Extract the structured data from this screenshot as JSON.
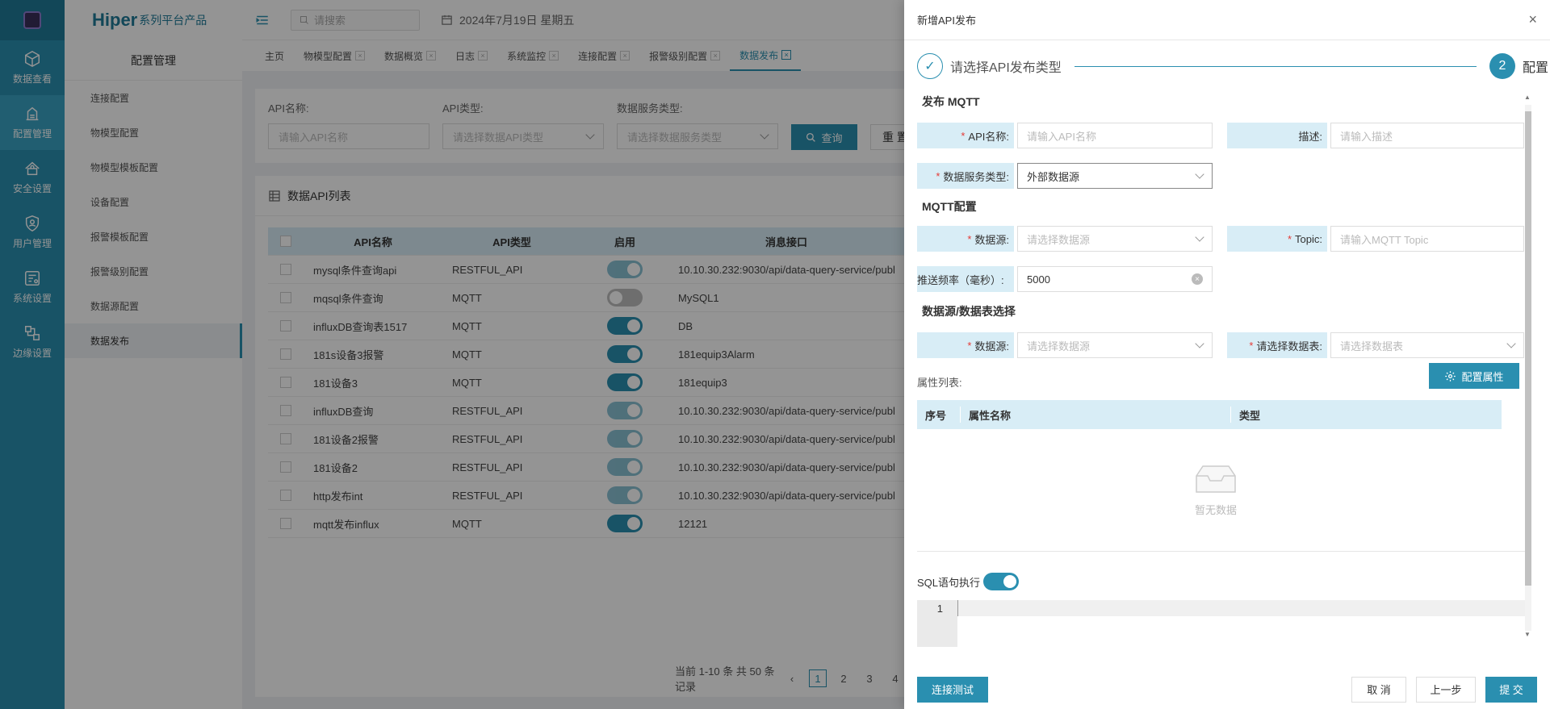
{
  "rail": {
    "items": [
      {
        "label": "数据查看",
        "icon": "cube-icon"
      },
      {
        "label": "配置管理",
        "icon": "config-icon",
        "active": true
      },
      {
        "label": "安全设置",
        "icon": "lock-icon"
      },
      {
        "label": "用户管理",
        "icon": "user-shield-icon"
      },
      {
        "label": "系统设置",
        "icon": "system-settings-icon"
      },
      {
        "label": "边缘设置",
        "icon": "edge-network-icon"
      }
    ]
  },
  "brand": {
    "name": "Hiper",
    "suffix": "系列平台产品"
  },
  "sidebar": {
    "title": "配置管理",
    "items": [
      "连接配置",
      "物模型配置",
      "物模型模板配置",
      "设备配置",
      "报警模板配置",
      "报警级别配置",
      "数据源配置",
      "数据发布"
    ],
    "active_index": 7
  },
  "header": {
    "search_placeholder": "请搜索",
    "date": "2024年7月19日 星期五"
  },
  "tabs": [
    {
      "label": "主页",
      "closable": false
    },
    {
      "label": "物模型配置",
      "closable": true
    },
    {
      "label": "数据概览",
      "closable": true
    },
    {
      "label": "日志",
      "closable": true
    },
    {
      "label": "系统监控",
      "closable": true
    },
    {
      "label": "连接配置",
      "closable": true
    },
    {
      "label": "报警级别配置",
      "closable": true
    },
    {
      "label": "数据发布",
      "closable": true,
      "active": true
    }
  ],
  "filter": {
    "api_name_label": "API名称:",
    "api_name_placeholder": "请输入API名称",
    "api_type_label": "API类型:",
    "api_type_placeholder": "请选择数据API类型",
    "service_type_label": "数据服务类型:",
    "service_type_placeholder": "请选择数据服务类型",
    "query_label": "查询",
    "reset_label": "重 置"
  },
  "table": {
    "title": "数据API列表",
    "columns": [
      "API名称",
      "API类型",
      "启用",
      "消息接口"
    ],
    "rows": [
      {
        "name": "mysql条件查询api",
        "type": "RESTFUL_API",
        "enabled": true,
        "endpoint": "10.10.30.232:9030/api/data-query-service/publ"
      },
      {
        "name": "mqsql条件查询",
        "type": "MQTT",
        "enabled": false,
        "endpoint": "MySQL1"
      },
      {
        "name": "influxDB查询表1517",
        "type": "MQTT",
        "enabled": true,
        "endpoint": "DB"
      },
      {
        "name": "181s设备3报警",
        "type": "MQTT",
        "enabled": true,
        "endpoint": "181equip3Alarm"
      },
      {
        "name": "181设备3",
        "type": "MQTT",
        "enabled": true,
        "endpoint": "181equip3"
      },
      {
        "name": "influxDB查询",
        "type": "RESTFUL_API",
        "enabled": true,
        "endpoint": "10.10.30.232:9030/api/data-query-service/publ"
      },
      {
        "name": "181设备2报警",
        "type": "RESTFUL_API",
        "enabled": true,
        "endpoint": "10.10.30.232:9030/api/data-query-service/publ"
      },
      {
        "name": "181设备2",
        "type": "RESTFUL_API",
        "enabled": true,
        "endpoint": "10.10.30.232:9030/api/data-query-service/publ"
      },
      {
        "name": "http发布int",
        "type": "RESTFUL_API",
        "enabled": true,
        "endpoint": "10.10.30.232:9030/api/data-query-service/publ"
      },
      {
        "name": "mqtt发布influx",
        "type": "MQTT",
        "enabled": true,
        "endpoint": "12121"
      }
    ],
    "pager": {
      "summary": "当前 1-10 条 共 50 条 记录",
      "prev": "‹",
      "pages": [
        "1",
        "2",
        "3",
        "4"
      ],
      "current": "1"
    }
  },
  "drawer": {
    "title": "新增API发布",
    "close": "×",
    "step1": "请选择API发布类型",
    "step1_check": "✓",
    "step2_num": "2",
    "step2": "配置",
    "section_publish": "发布 MQTT",
    "api_name_label": "API名称:",
    "api_name_placeholder": "请输入API名称",
    "desc_label": "描述:",
    "desc_placeholder": "请输入描述",
    "service_type_label": "数据服务类型:",
    "service_type_value": "外部数据源",
    "section_mqtt": "MQTT配置",
    "datasource_label": "数据源:",
    "datasource_placeholder": "请选择数据源",
    "topic_label": "Topic:",
    "topic_placeholder": "请输入MQTT Topic",
    "freq_label": "推送频率（毫秒）:",
    "freq_value": "5000",
    "clear": "×",
    "section_select": "数据源/数据表选择",
    "ds2_label": "数据源:",
    "ds2_placeholder": "请选择数据源",
    "table_label": "请选择数据表:",
    "table_placeholder": "请选择数据表",
    "attr_list_label": "属性列表:",
    "config_attr_label": "配置属性",
    "attr_columns": [
      "序号",
      "属性名称",
      "类型"
    ],
    "empty_text": "暂无数据",
    "sql_label": "SQL语句执行",
    "sql_enabled": true,
    "editor_line": "1",
    "test_label": "连接测试",
    "cancel_label": "取 消",
    "prev_label": "上一步",
    "submit_label": "提 交"
  },
  "colors": {
    "primary": "#2a8fb0",
    "rail": "#2a8fb0",
    "header_cell": "#d8edf6",
    "required": "#e53935"
  }
}
